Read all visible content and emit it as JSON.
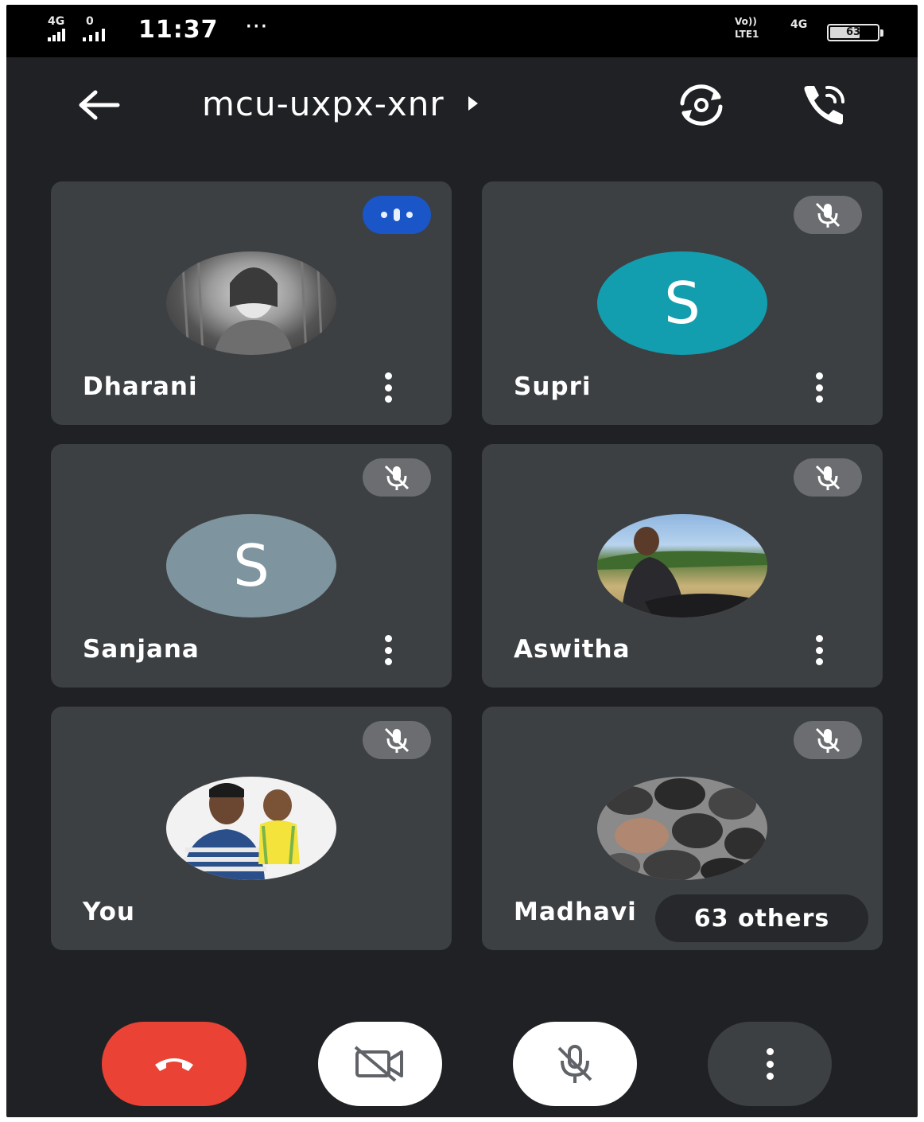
{
  "status_bar": {
    "left_net_1_top": "4G",
    "left_net_2_top": "0",
    "time": "11:37",
    "more_dots": "···",
    "right_carrier_top": "Vo))",
    "right_carrier_bottom": "LTE1",
    "right_net": "4G",
    "battery_level": "63",
    "battery_fraction": 0.63
  },
  "app_bar": {
    "meeting_code": "mcu-uxpx-xnr"
  },
  "participants": [
    {
      "name": "Dharani",
      "avatar_type": "photo",
      "status": "speaking"
    },
    {
      "name": "Supri",
      "avatar_type": "letter",
      "avatar_letter": "S",
      "avatar_color": "#129eaf",
      "status": "muted"
    },
    {
      "name": "Sanjana",
      "avatar_type": "letter",
      "avatar_letter": "S",
      "avatar_color": "#7e949e",
      "status": "muted"
    },
    {
      "name": "Aswitha",
      "avatar_type": "photo",
      "status": "muted"
    },
    {
      "name": "You",
      "avatar_type": "photo",
      "status": "muted"
    },
    {
      "name": "Madhavi",
      "avatar_type": "photo",
      "status": "muted"
    }
  ],
  "others_chip": {
    "label": "63 others"
  },
  "controls": {
    "end_call_color": "#ea4335"
  }
}
